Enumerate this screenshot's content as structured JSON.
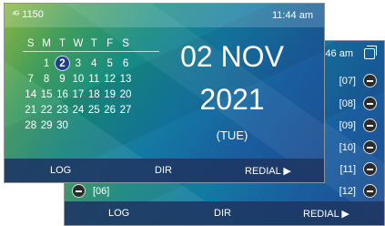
{
  "front": {
    "status": {
      "extension": "1150",
      "time": "11:44 am"
    },
    "calendar": {
      "weekdays": [
        "S",
        "M",
        "T",
        "W",
        "T",
        "F",
        "S"
      ],
      "weeks": [
        [
          "",
          "1",
          "2",
          "3",
          "4",
          "5",
          "6"
        ],
        [
          "7",
          "8",
          "9",
          "10",
          "11",
          "12",
          "13"
        ],
        [
          "14",
          "15",
          "16",
          "17",
          "18",
          "19",
          "20"
        ],
        [
          "21",
          "22",
          "23",
          "24",
          "25",
          "26",
          "27"
        ],
        [
          "28",
          "29",
          "30",
          "",
          "",
          "",
          ""
        ]
      ],
      "selected_day": "2"
    },
    "date_display": {
      "day_month": "02 NOV",
      "year": "2021",
      "weekday": "(TUE)"
    },
    "softkeys": {
      "log": "LOG",
      "dir": "DIR",
      "redial": "REDIAL ▶"
    }
  },
  "back": {
    "status": {
      "time_partial": "46 am"
    },
    "memory_keys": [
      "[07]",
      "[08]",
      "[09]",
      "[10]",
      "[11]",
      "[12]"
    ],
    "memory_key_left": "[06]",
    "softkeys": {
      "log": "LOG",
      "dir": "DIR",
      "redial": "REDIAL ▶"
    }
  }
}
